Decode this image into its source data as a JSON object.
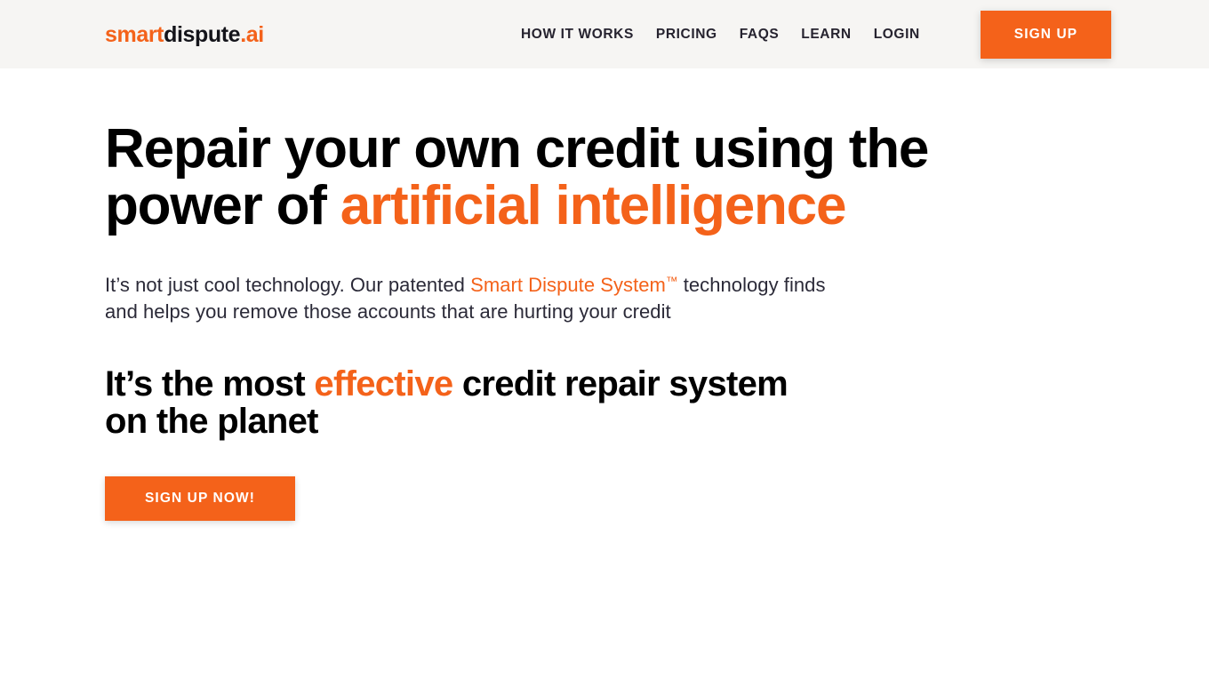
{
  "header": {
    "background_color": "#f6f5f3",
    "logo": {
      "part1": "smart",
      "part2": "dispute",
      "part3": ".ai",
      "full_text": "smartdispute.ai"
    },
    "nav": [
      {
        "label": "HOW IT WORKS"
      },
      {
        "label": "PRICING"
      },
      {
        "label": "FAQS"
      },
      {
        "label": "LEARN"
      },
      {
        "label": "LOGIN"
      }
    ],
    "signup_button": {
      "label": "SIGN UP",
      "background_color": "#f4621a",
      "text_color": "#ffffff"
    }
  },
  "hero": {
    "title": {
      "lead": "Repair your own credit using the power of ",
      "accent": "artificial intelligence",
      "full_text": "Repair your own credit using the power of artificial intelligence",
      "color": "#000000",
      "accent_color": "#f4621a"
    },
    "paragraph": {
      "before_link": "It’s not just cool technology. Our patented ",
      "link_text": "Smart Dispute System",
      "link_superscript": "™",
      "after_link": " technology finds and helps you remove those accounts that are hurting your credit",
      "full_text": "It’s not just cool technology. Our patented Smart Dispute System™ technology finds and helps you remove those accounts that are hurting your credit",
      "color": "#2b2a38",
      "link_color": "#f4621a"
    },
    "subtitle": {
      "before_accent": "It’s the most ",
      "accent": "effective",
      "after_accent": " credit repair system on the planet",
      "full_text": "It’s the most effective credit repair system on the planet",
      "color": "#000000",
      "accent_color": "#f4621a"
    },
    "cta_button": {
      "label": "SIGN UP NOW!",
      "background_color": "#f4621a",
      "text_color": "#ffffff"
    }
  },
  "page": {
    "background_color": "#ffffff",
    "brand_accent_color": "#f4621a",
    "text_dark_color": "#26232f"
  }
}
